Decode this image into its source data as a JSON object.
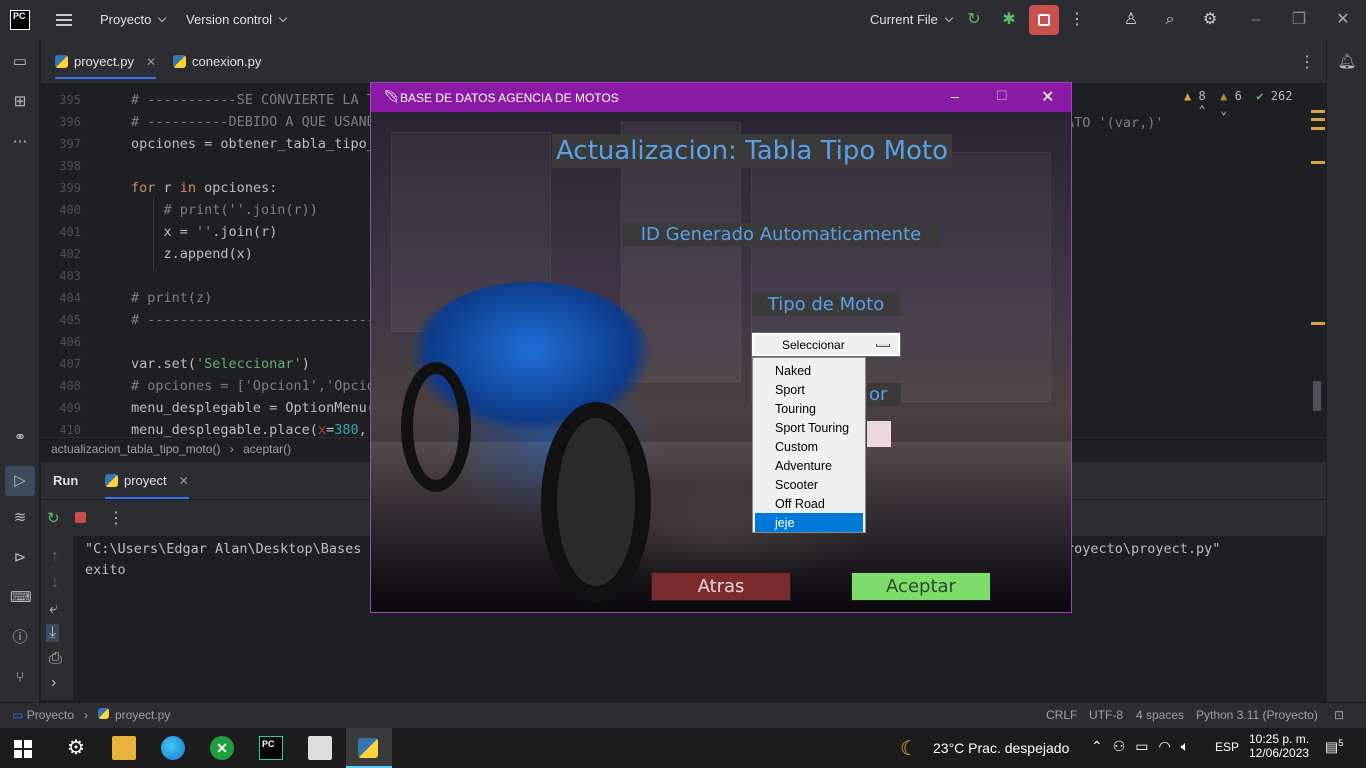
{
  "ide": {
    "logo": "PC",
    "menus": [
      "Proyecto",
      "Version control"
    ],
    "run_config": "Current File",
    "toolbar_icons": [
      "rerun-icon",
      "debug-icon",
      "stop-icon",
      "more-icon",
      "add-user-icon",
      "search-icon",
      "settings-icon"
    ],
    "tabs": [
      {
        "label": "proyect.py",
        "active": true
      },
      {
        "label": "conexion.py",
        "active": false
      }
    ],
    "inspections": {
      "warnings": "8",
      "weak": "6",
      "ok": "262"
    },
    "code_lines": [
      {
        "n": "395",
        "text": "# -----------SE CONVIERTE LA T"
      },
      {
        "n": "396",
        "text": "# ----------DEBIDO A QUE USAND"
      },
      {
        "n": "397",
        "text": "opciones = obtener_tabla_tipo_"
      },
      {
        "n": "398",
        "text": ""
      },
      {
        "n": "399",
        "text": "for r in opciones:"
      },
      {
        "n": "400",
        "text": "    # print(''.join(r))"
      },
      {
        "n": "401",
        "text": "    x = ''.join(r)"
      },
      {
        "n": "402",
        "text": "    z.append(x)"
      },
      {
        "n": "403",
        "text": ""
      },
      {
        "n": "404",
        "text": "# print(z)"
      },
      {
        "n": "405",
        "text": "# ----------------------------"
      },
      {
        "n": "406",
        "text": ""
      },
      {
        "n": "407",
        "text": "var.set('Seleccionar')"
      },
      {
        "n": "408",
        "text": "# opciones = ['Opcion1','Opcio"
      },
      {
        "n": "409",
        "text": "menu_desplegable = OptionMenu("
      },
      {
        "n": "410",
        "text": "menu_desplegable.place(x=380,"
      }
    ],
    "code_right_fragment": "ATO '(var,)'",
    "breadcrumb": [
      "actualizacion_tabla_tipo_moto()",
      "aceptar()"
    ],
    "run_panel": {
      "title": "Run",
      "tab": "proyect",
      "console": [
        "\"C:\\Users\\Edgar Alan\\Desktop\\Bases d",
        "exito"
      ],
      "console_right": "royecto\\proyect.py\""
    },
    "statusbar": {
      "project": "Proyecto",
      "file": "proyect.py",
      "line_sep": "CRLF",
      "encoding": "UTF-8",
      "indent": "4 spaces",
      "interpreter": "Python 3.11 (Proyecto)"
    }
  },
  "tk_window": {
    "title": "BASE DE DATOS AGENCIA DE MOTOS",
    "heading": "Actualizacion: Tabla Tipo Moto",
    "id_label": "ID Generado Automaticamente",
    "tipo_label": "Tipo de Moto",
    "hidden_label_fragment": "or",
    "option_menu": {
      "selected": "Seleccionar",
      "options": [
        "Naked",
        "Sport",
        "Touring",
        "Sport Touring",
        "Custom",
        "Adventure",
        "Scooter",
        "Off Road",
        "jeje"
      ],
      "highlighted": "jeje"
    },
    "btn_back": "Atras",
    "btn_accept": "Aceptar",
    "colors": {
      "back": "#7b2a2e",
      "accept": "#7ddc6a",
      "label_text": "#5aa0e6",
      "title_bar": "#8a1aa6"
    }
  },
  "taskbar": {
    "weather": "23°C  Prac. despejado",
    "lang": "ESP",
    "time": "10:25 p. m.",
    "date": "12/06/2023",
    "notifications": "5"
  }
}
